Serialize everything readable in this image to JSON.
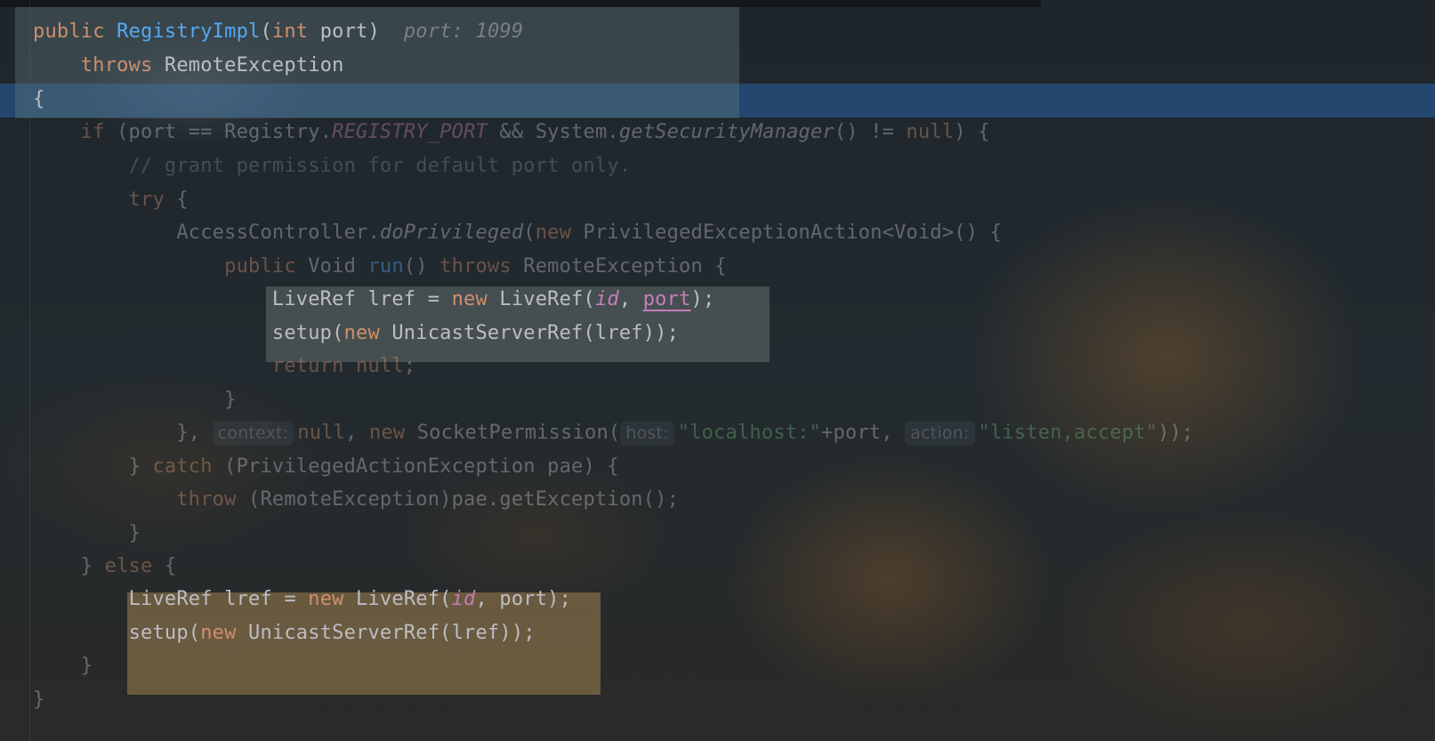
{
  "code": {
    "l1": {
      "kw": "public",
      "name": "RegistryImpl",
      "p1": "(",
      "kw2": "int",
      "p2": " port)",
      "hint": "port: 1099"
    },
    "l2": {
      "kw": "throws",
      "type": "RemoteException"
    },
    "l3": {
      "brace": "{"
    },
    "l4": {
      "kw": "if",
      "a": " (port == Registry.",
      "const": "REGISTRY_PORT",
      "b": " && System.",
      "method": "getSecurityManager",
      "c": "() != ",
      "kw2": "null",
      "d": ") {"
    },
    "l5": {
      "comment": "// grant permission for default port only."
    },
    "l6": {
      "kw": "try",
      "a": " {"
    },
    "l7": {
      "a": "AccessController.",
      "method": "doPrivileged",
      "b": "(",
      "kw": "new",
      "c": " PrivilegedExceptionAction<Void>() {"
    },
    "l8": {
      "kw": "public",
      "a": " Void ",
      "fn": "run",
      "b": "() ",
      "kw2": "throws",
      "c": " RemoteException {"
    },
    "l9": {
      "a": "LiveRef lref = ",
      "kw": "new",
      "b": " LiveRef(",
      "field": "id",
      "c": ", ",
      "param": "port",
      "d": ");"
    },
    "l10": {
      "a": "setup(",
      "kw": "new",
      "b": " UnicastServerRef(lref));"
    },
    "l11": {
      "kw": "return",
      "kw2": "null",
      "a": ";"
    },
    "l12": {
      "a": "}"
    },
    "l13": {
      "a": "}, ",
      "hint1": "context:",
      "kw": "null",
      "b": ", ",
      "kw2": "new",
      "c": " SocketPermission(",
      "hint2": "host:",
      "str1": "\"localhost:\"",
      "d": "+port, ",
      "hint3": "action:",
      "str2": "\"listen,accept\"",
      "e": "));"
    },
    "l14": {
      "a": "} ",
      "kw": "catch",
      "b": " (PrivilegedActionException pae) {"
    },
    "l15": {
      "kw": "throw",
      "a": " (RemoteException)pae.getException();"
    },
    "l16": {
      "a": "}"
    },
    "l17": {
      "a": "} ",
      "kw": "else",
      "b": " {"
    },
    "l18": {
      "a": "LiveRef lref = ",
      "kw": "new",
      "b": " LiveRef(",
      "field": "id",
      "c": ", port);"
    },
    "l19": {
      "a": "setup(",
      "kw": "new",
      "b": " UnicastServerRef(lref));"
    },
    "l20": {
      "a": "}"
    },
    "l21": {
      "a": "}"
    }
  },
  "colors": {
    "keyword": "#cf8e6d",
    "function": "#56a8f5",
    "identifier": "#bcbec4",
    "comment": "#7a7e85",
    "string": "#6aab73",
    "constant": "#c77dbb",
    "caret_line": "#286ebe",
    "selection_warm": "#a08250"
  }
}
